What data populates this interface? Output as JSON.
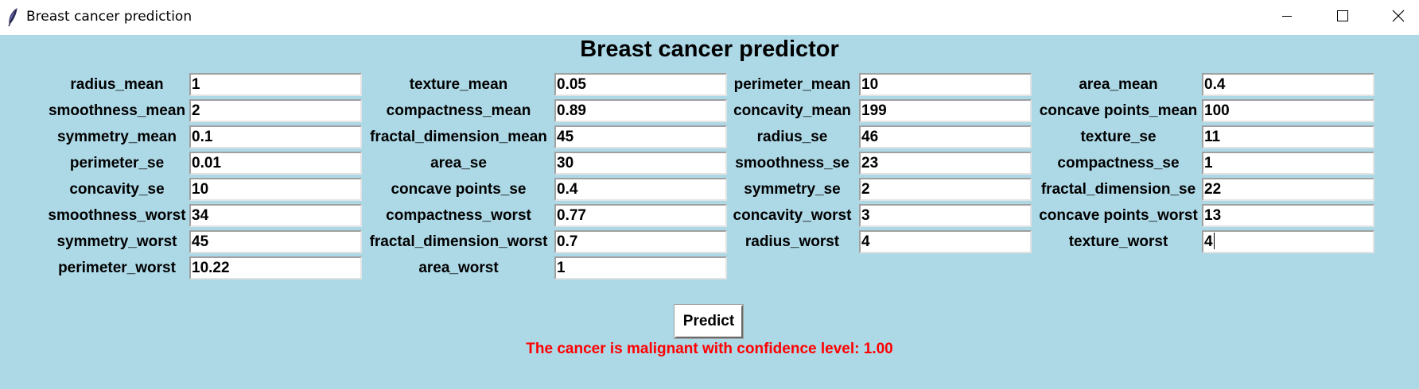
{
  "window": {
    "title": "Breast cancer prediction",
    "controls": [
      "minimize-icon",
      "maximize-icon",
      "close-icon"
    ]
  },
  "heading": "Breast cancer predictor",
  "fields": [
    [
      {
        "label": "radius_mean",
        "value": "1"
      },
      {
        "label": "texture_mean",
        "value": "0.05"
      },
      {
        "label": "perimeter_mean",
        "value": "10"
      },
      {
        "label": "area_mean",
        "value": "0.4"
      }
    ],
    [
      {
        "label": "smoothness_mean",
        "value": "2"
      },
      {
        "label": "compactness_mean",
        "value": "0.89"
      },
      {
        "label": "concavity_mean",
        "value": "199"
      },
      {
        "label": "concave points_mean",
        "value": "100"
      }
    ],
    [
      {
        "label": "symmetry_mean",
        "value": "0.1"
      },
      {
        "label": "fractal_dimension_mean",
        "value": "45"
      },
      {
        "label": "radius_se",
        "value": "46"
      },
      {
        "label": "texture_se",
        "value": "11"
      }
    ],
    [
      {
        "label": "perimeter_se",
        "value": "0.01"
      },
      {
        "label": "area_se",
        "value": "30"
      },
      {
        "label": "smoothness_se",
        "value": "23"
      },
      {
        "label": "compactness_se",
        "value": "1"
      }
    ],
    [
      {
        "label": "concavity_se",
        "value": "10"
      },
      {
        "label": "concave points_se",
        "value": "0.4"
      },
      {
        "label": "symmetry_se",
        "value": "2"
      },
      {
        "label": "fractal_dimension_se",
        "value": "22"
      }
    ],
    [
      {
        "label": "smoothness_worst",
        "value": "34"
      },
      {
        "label": "compactness_worst",
        "value": "0.77"
      },
      {
        "label": "concavity_worst",
        "value": "3"
      },
      {
        "label": "concave points_worst",
        "value": "13"
      }
    ],
    [
      {
        "label": "symmetry_worst",
        "value": "45"
      },
      {
        "label": "fractal_dimension_worst",
        "value": "0.7"
      },
      {
        "label": "radius_worst",
        "value": "4"
      },
      {
        "label": "texture_worst",
        "value": "4"
      }
    ],
    [
      {
        "label": "perimeter_worst",
        "value": "10.22"
      },
      {
        "label": "area_worst",
        "value": "1"
      }
    ]
  ],
  "predict_button": "Predict",
  "result_text": "The cancer is malignant with confidence level: 1.00",
  "colors": {
    "background": "#add8e6",
    "result": "#ff0000"
  }
}
